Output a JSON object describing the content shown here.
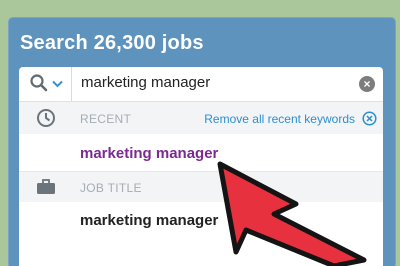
{
  "header": {
    "title": "Search 26,300 jobs"
  },
  "search": {
    "value": "marketing manager",
    "scope_icon": "search-icon",
    "clear_icon": "clear-icon"
  },
  "dropdown": {
    "recent": {
      "label": "RECENT",
      "icon": "clock-icon",
      "action_label": "Remove all recent keywords",
      "action_icon": "close-circle-icon",
      "items": [
        "marketing manager"
      ]
    },
    "job_title": {
      "label": "JOB TITLE",
      "icon": "briefcase-icon",
      "items": [
        "marketing manager"
      ]
    }
  },
  "colors": {
    "panel": "#5e93bd",
    "link": "#2f8fce",
    "recent_item": "#7b2a91",
    "arrow": "#e8313f",
    "background": "#a9c79a"
  }
}
